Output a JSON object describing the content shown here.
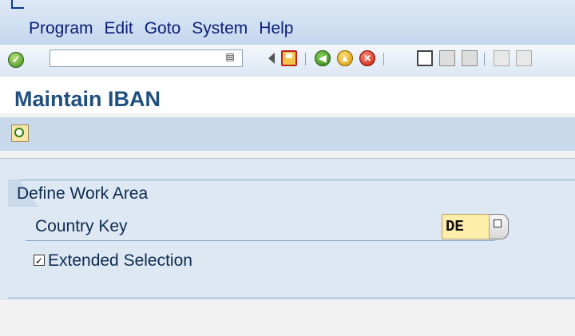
{
  "menu": [
    "Program",
    "Edit",
    "Goto",
    "System",
    "Help"
  ],
  "toolbar": {
    "command_value": "",
    "icons": [
      "enter-icon",
      "command-dropdown-icon",
      "back-triangle-icon",
      "save-icon",
      "back-icon",
      "exit-icon",
      "cancel-icon",
      "print-icon",
      "find-icon",
      "find-next-icon",
      "first-page-icon",
      "previous-page-icon"
    ]
  },
  "page": {
    "title": "Maintain IBAN"
  },
  "app_toolbar": {
    "icons": [
      "execute-clock-icon"
    ]
  },
  "work_area": {
    "group_title": "Define Work Area",
    "country_label": "Country Key",
    "country_value": "DE",
    "extended_selection_label": "Extended Selection",
    "extended_selection_checked": "☑"
  },
  "colors": {
    "title": "#1f4f7f",
    "menu_text": "#0a1e78",
    "input_bg": "#ffedaa",
    "work_bg": "#dde8f3"
  }
}
